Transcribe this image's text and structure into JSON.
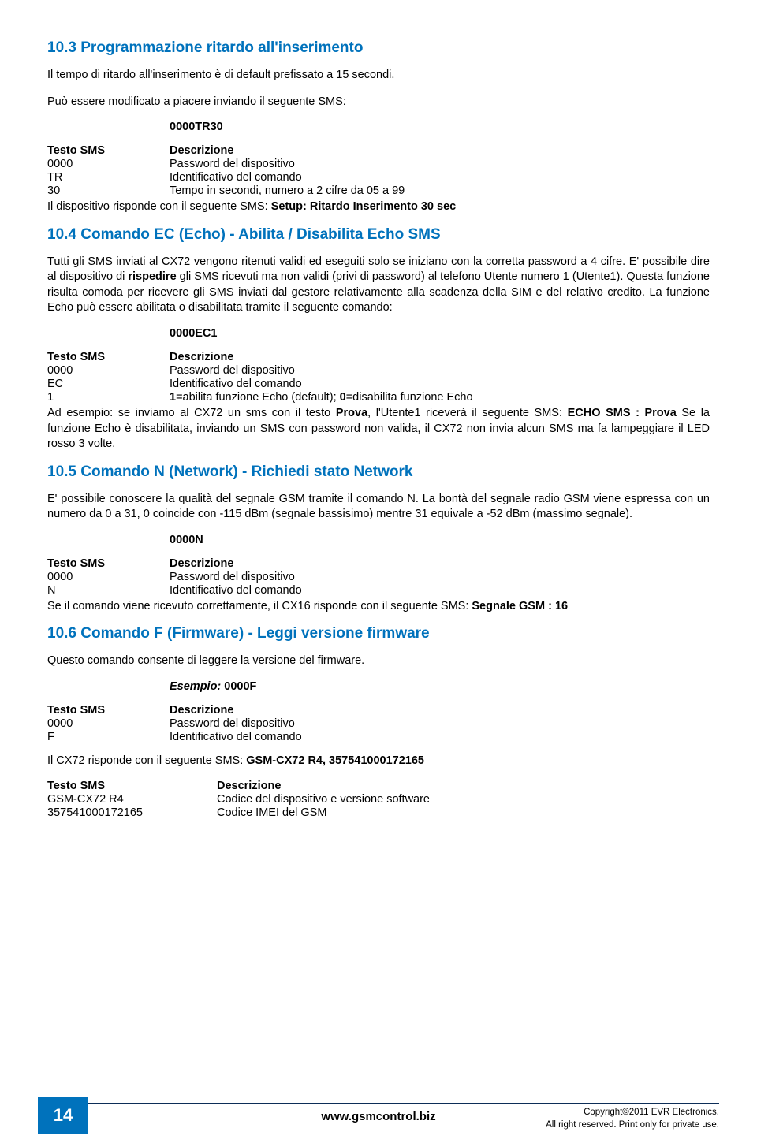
{
  "s103": {
    "title": "10.3 Programmazione ritardo all'inserimento",
    "p1": "Il tempo di ritardo all'inserimento è di default prefissato a 15 secondi.",
    "p2": "Può essere modificato a piacere inviando il seguente SMS:",
    "example": "0000TR30",
    "hdr_l": "Testo SMS",
    "hdr_r": "Descrizione",
    "r1l": "0000",
    "r1r": "Password del dispositivo",
    "r2l": "TR",
    "r2r": "Identificativo del comando",
    "r3l": "30",
    "r3r": "Tempo in secondi, numero a 2 cifre da 05 a 99",
    "after": "Il dispositivo risponde con il seguente SMS: ",
    "after_b": "Setup: Ritardo Inserimento 30 sec"
  },
  "s104": {
    "title": "10.4 Comando EC (Echo) - Abilita / Disabilita Echo SMS",
    "p1a": "Tutti gli SMS inviati al CX72 vengono ritenuti validi ed eseguiti solo se iniziano con la corretta password a 4 cifre. E' possibile dire al dispositivo di ",
    "p1b": "rispedire",
    "p1c": " gli SMS ricevuti ma non validi (privi di password) al telefono Utente numero 1 (Utente1). Questa funzione risulta comoda per ricevere gli SMS inviati dal gestore relativamente alla scadenza della SIM e del relativo credito. La funzione Echo può essere abilitata o disabilitata tramite il seguente comando:",
    "example": "0000EC1",
    "hdr_l": "Testo SMS",
    "hdr_r": "Descrizione",
    "r1l": "0000",
    "r1r": "Password del dispositivo",
    "r2l": "EC",
    "r2r": "Identificativo del comando",
    "r3l": "1",
    "r3r_a": "1",
    "r3r_b": "=abilita funzione Echo (default); ",
    "r3r_c": "0",
    "r3r_d": "=disabilita funzione Echo",
    "after1a": "Ad esempio: se inviamo al CX72 un sms con il testo ",
    "after1b": "Prova",
    "after1c": ", l'Utente1 riceverà il seguente SMS: ",
    "after1d": "ECHO SMS : Prova",
    "after2": "Se la funzione Echo è disabilitata, inviando un SMS con password non valida, il CX72 non invia alcun SMS ma fa lampeggiare il LED rosso 3 volte."
  },
  "s105": {
    "title": "10.5 Comando N (Network) - Richiedi stato Network",
    "p1": "E' possibile conoscere la qualità del segnale GSM tramite il comando N. La bontà del segnale radio GSM viene espressa con un numero da 0 a 31, 0 coincide con -115 dBm (segnale bassisimo) mentre 31 equivale a -52 dBm (massimo segnale).",
    "example": "0000N",
    "hdr_l": "Testo SMS",
    "hdr_r": "Descrizione",
    "r1l": "0000",
    "r1r": "Password del dispositivo",
    "r2l": "N",
    "r2r": "Identificativo del comando",
    "after_a": "Se il comando viene ricevuto correttamente, il CX16 risponde con il seguente SMS: ",
    "after_b": "Segnale GSM : 16"
  },
  "s106": {
    "title": "10.6 Comando F (Firmware) - Leggi versione firmware",
    "p1": "Questo comando consente di leggere la versione del firmware.",
    "example_pre": "Esempio: ",
    "example": "0000F",
    "hdr_l": "Testo SMS",
    "hdr_r": "Descrizione",
    "r1l": "0000",
    "r1r": "Password del dispositivo",
    "r2l": "F",
    "r2r": "Identificativo del comando",
    "after_a": "Il CX72 risponde con il seguente SMS: ",
    "after_b": "GSM-CX72 R4, 357541000172165",
    "t2_hdr_l": "Testo SMS",
    "t2_hdr_r": "Descrizione",
    "t2_r1l": "GSM-CX72 R4",
    "t2_r1r": "Codice del dispositivo e versione software",
    "t2_r2l": "357541000172165",
    "t2_r2r": "Codice IMEI del GSM"
  },
  "footer": {
    "page": "14",
    "url": "www.gsmcontrol.biz",
    "copy1": "Copyright©2011 EVR Electronics.",
    "copy2": "All right reserved. Print only for private use."
  }
}
